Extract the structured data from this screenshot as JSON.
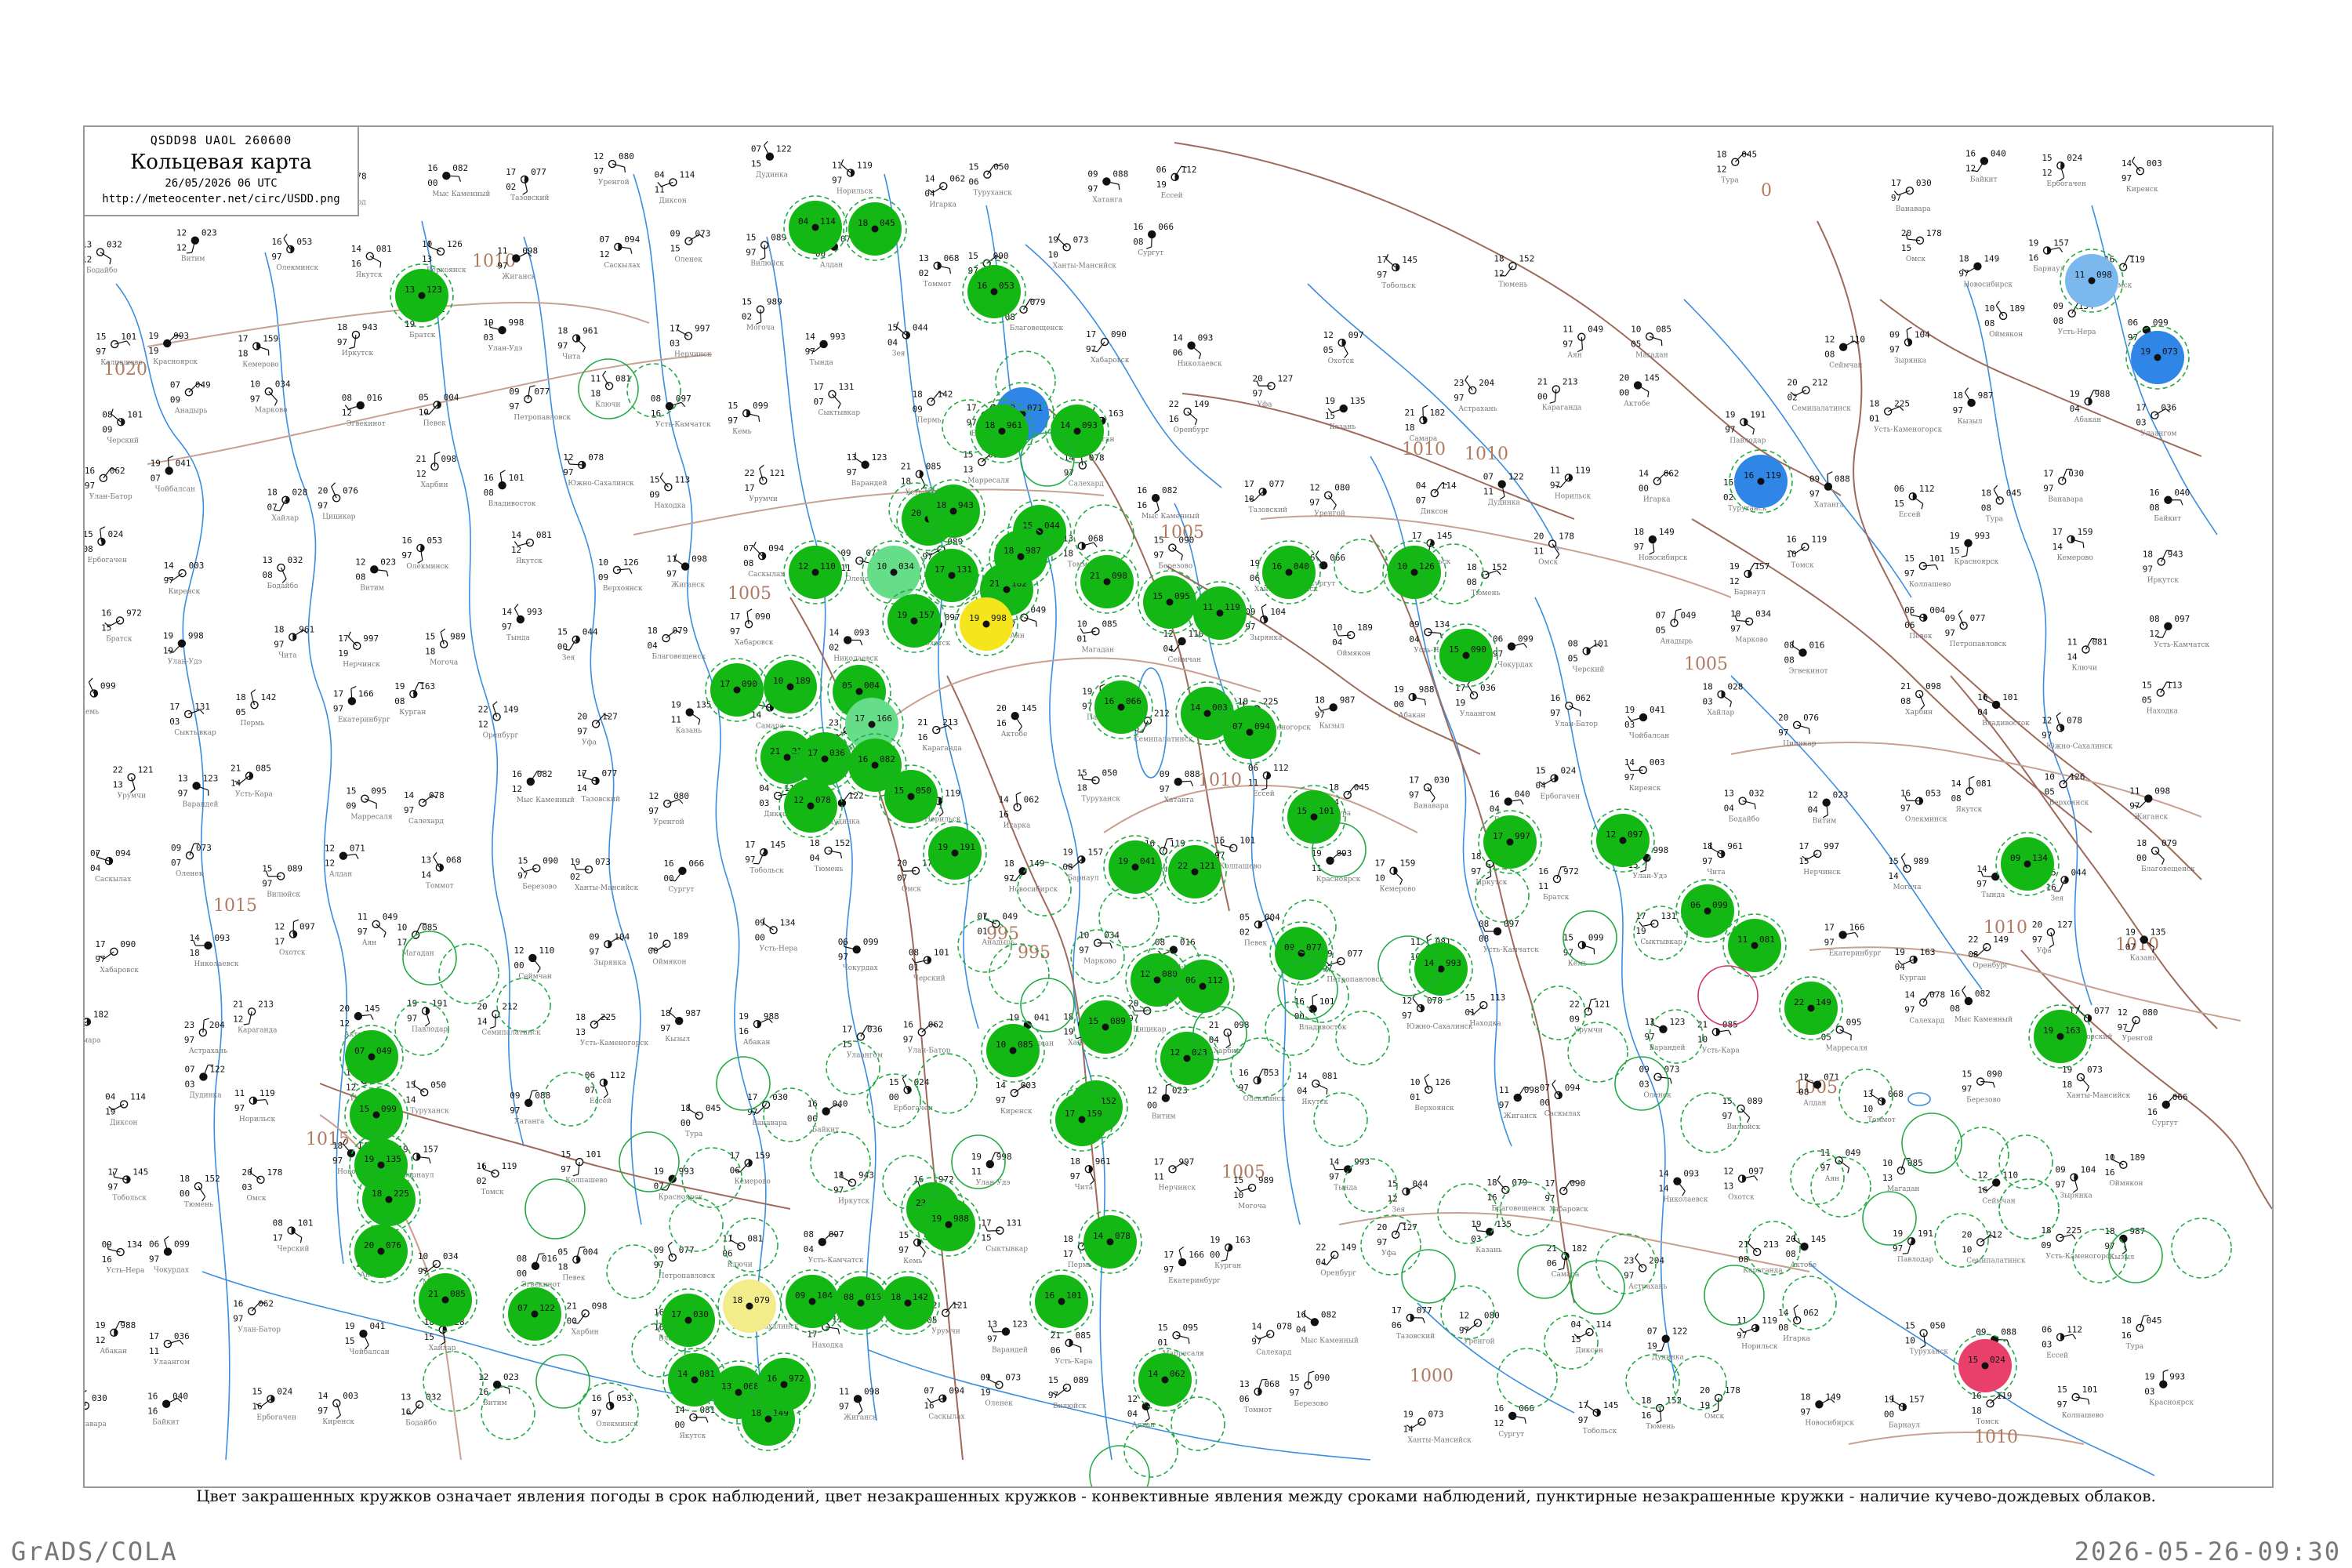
{
  "header": {
    "code": "QSDD98  UAOL  260600",
    "title": "Кольцевая карта",
    "datetime": "26/05/2026 06 UTC",
    "url": "http://meteocenter.net/circ/USDD.png"
  },
  "caption": "Цвет закрашенных кружков означает явления погоды в срок наблюдений, цвет незакрашенных кружков - конвективные явления между сроками наблюдений, пунктирные незакрашенные кружки - наличие кучево-дождевых облаков.",
  "footer": {
    "left": "GrADS/COLA",
    "right": "2026-05-26-09:30"
  },
  "colors": {
    "frame": "#9a9a9a",
    "river": "#3a8ee0",
    "border": "#a06a5a",
    "isobar": "#c9a090",
    "rain_green": "#14b814",
    "light_green": "#66dd88",
    "yellow": "#f5e51c",
    "pale_yellow": "#f2ec8a",
    "blue": "#2f86e6",
    "light_blue": "#7ab8ee",
    "red": "#e8406a",
    "convective_outline": "#22aa44",
    "thunder_outline": "#d03070"
  },
  "isobar_labels": [
    "1020",
    "1015",
    "1010",
    "1010",
    "1005",
    "1005",
    "1010",
    "995",
    "1005",
    "1005",
    "995",
    "1010",
    "1010",
    "1010",
    "1015",
    "1005",
    "1000",
    "1010",
    "0"
  ],
  "stations": [
    {
      "n": "Варандей",
      "p": "123",
      "t": "13"
    },
    {
      "n": "Усть-Кара",
      "p": "085",
      "t": "21"
    },
    {
      "n": "Марресаля",
      "p": "095",
      "t": "15"
    },
    {
      "n": "Салехард",
      "p": "078",
      "t": "14"
    },
    {
      "n": "Мыс Каменный",
      "p": "082",
      "t": "16"
    },
    {
      "n": "Тазовский",
      "p": "077",
      "t": "17"
    },
    {
      "n": "Уренгой",
      "p": "080",
      "t": "12"
    },
    {
      "n": "Диксон",
      "p": "114",
      "t": "04"
    },
    {
      "n": "Дудинка",
      "p": "122",
      "t": "07"
    },
    {
      "n": "Норильск",
      "p": "119",
      "t": "11"
    },
    {
      "n": "Игарка",
      "p": "062",
      "t": "14"
    },
    {
      "n": "Туруханск",
      "p": "050",
      "t": "15"
    },
    {
      "n": "Хатанга",
      "p": "088",
      "t": "09"
    },
    {
      "n": "Ессей",
      "p": "112",
      "t": "06"
    },
    {
      "n": "Тура",
      "p": "045",
      "t": "18"
    },
    {
      "n": "Ванавара",
      "p": "030",
      "t": "17"
    },
    {
      "n": "Байкит",
      "p": "040",
      "t": "16"
    },
    {
      "n": "Ербогачен",
      "p": "024",
      "t": "15"
    },
    {
      "n": "Киренск",
      "p": "003",
      "t": "14"
    },
    {
      "n": "Бодайбо",
      "p": "032",
      "t": "13"
    },
    {
      "n": "Витим",
      "p": "023",
      "t": "12"
    },
    {
      "n": "Олекминск",
      "p": "053",
      "t": "16"
    },
    {
      "n": "Якутск",
      "p": "081",
      "t": "14"
    },
    {
      "n": "Верхоянск",
      "p": "126",
      "t": "10"
    },
    {
      "n": "Жиганск",
      "p": "098",
      "t": "11"
    },
    {
      "n": "Саскылах",
      "p": "094",
      "t": "07"
    },
    {
      "n": "Оленек",
      "p": "073",
      "t": "09"
    },
    {
      "n": "Вилюйск",
      "p": "089",
      "t": "15"
    },
    {
      "n": "Алдан",
      "p": "071",
      "t": "12"
    },
    {
      "n": "Томмот",
      "p": "068",
      "t": "13"
    },
    {
      "n": "Березово",
      "p": "090",
      "t": "15"
    },
    {
      "n": "Ханты-Мансийск",
      "p": "073",
      "t": "19"
    },
    {
      "n": "Сургут",
      "p": "066",
      "t": "16"
    },
    {
      "n": "Тобольск",
      "p": "145",
      "t": "17"
    },
    {
      "n": "Тюмень",
      "p": "152",
      "t": "18"
    },
    {
      "n": "Омск",
      "p": "178",
      "t": "20"
    },
    {
      "n": "Новосибирск",
      "p": "149",
      "t": "18"
    },
    {
      "n": "Барнаул",
      "p": "157",
      "t": "19"
    },
    {
      "n": "Томск",
      "p": "119",
      "t": "16"
    },
    {
      "n": "Колпашево",
      "p": "101",
      "t": "15"
    },
    {
      "n": "Красноярск",
      "p": "993",
      "t": "19"
    },
    {
      "n": "Кемерово",
      "p": "159",
      "t": "17"
    },
    {
      "n": "Иркутск",
      "p": "943",
      "t": "18"
    },
    {
      "n": "Братск",
      "p": "972",
      "t": "16"
    },
    {
      "n": "Улан-Удэ",
      "p": "998",
      "t": "19"
    },
    {
      "n": "Чита",
      "p": "961",
      "t": "18"
    },
    {
      "n": "Нерчинск",
      "p": "997",
      "t": "17"
    },
    {
      "n": "Могоча",
      "p": "989",
      "t": "15"
    },
    {
      "n": "Тында",
      "p": "993",
      "t": "14"
    },
    {
      "n": "Зея",
      "p": "044",
      "t": "15"
    },
    {
      "n": "Благовещенск",
      "p": "079",
      "t": "18"
    },
    {
      "n": "Хабаровск",
      "p": "090",
      "t": "17"
    },
    {
      "n": "Николаевск",
      "p": "093",
      "t": "14"
    },
    {
      "n": "Охотск",
      "p": "097",
      "t": "12"
    },
    {
      "n": "Аян",
      "p": "049",
      "t": "11"
    },
    {
      "n": "Магадан",
      "p": "085",
      "t": "10"
    },
    {
      "n": "Сеймчан",
      "p": "110",
      "t": "12"
    },
    {
      "n": "Зырянка",
      "p": "104",
      "t": "09"
    },
    {
      "n": "Оймякон",
      "p": "189",
      "t": "10"
    },
    {
      "n": "Усть-Нера",
      "p": "134",
      "t": "09"
    },
    {
      "n": "Чокурдах",
      "p": "099",
      "t": "06"
    },
    {
      "n": "Черский",
      "p": "101",
      "t": "08"
    },
    {
      "n": "Анадырь",
      "p": "049",
      "t": "07"
    },
    {
      "n": "Марково",
      "p": "034",
      "t": "10"
    },
    {
      "n": "Эгвекинот",
      "p": "016",
      "t": "08"
    },
    {
      "n": "Певек",
      "p": "004",
      "t": "05"
    },
    {
      "n": "Петропавловск",
      "p": "077",
      "t": "09"
    },
    {
      "n": "Ключи",
      "p": "081",
      "t": "11"
    },
    {
      "n": "Усть-Камчатск",
      "p": "097",
      "t": "08"
    },
    {
      "n": "Кемь",
      "p": "099",
      "t": "15"
    },
    {
      "n": "Сыктывкар",
      "p": "131",
      "t": "17"
    },
    {
      "n": "Пермь",
      "p": "142",
      "t": "18"
    },
    {
      "n": "Екатеринбург",
      "p": "166",
      "t": "17"
    },
    {
      "n": "Курган",
      "p": "163",
      "t": "19"
    },
    {
      "n": "Оренбург",
      "p": "149",
      "t": "22"
    },
    {
      "n": "Уфа",
      "p": "127",
      "t": "20"
    },
    {
      "n": "Казань",
      "p": "135",
      "t": "19"
    },
    {
      "n": "Самара",
      "p": "182",
      "t": "21"
    },
    {
      "n": "Астрахань",
      "p": "204",
      "t": "23"
    },
    {
      "n": "Караганда",
      "p": "213",
      "t": "21"
    },
    {
      "n": "Актобе",
      "p": "145",
      "t": "20"
    },
    {
      "n": "Павлодар",
      "p": "191",
      "t": "19"
    },
    {
      "n": "Семипалатинск",
      "p": "212",
      "t": "20"
    },
    {
      "n": "Усть-Каменогорск",
      "p": "225",
      "t": "18"
    },
    {
      "n": "Кызыл",
      "p": "987",
      "t": "18"
    },
    {
      "n": "Абакан",
      "p": "988",
      "t": "19"
    },
    {
      "n": "Улаангом",
      "p": "036",
      "t": "17"
    },
    {
      "n": "Улан-Батор",
      "p": "062",
      "t": "16"
    },
    {
      "n": "Чойбалсан",
      "p": "041",
      "t": "19"
    },
    {
      "n": "Хайлар",
      "p": "028",
      "t": "18"
    },
    {
      "n": "Цицикар",
      "p": "076",
      "t": "20"
    },
    {
      "n": "Харбин",
      "p": "098",
      "t": "21"
    },
    {
      "n": "Владивосток",
      "p": "101",
      "t": "16"
    },
    {
      "n": "Южно-Сахалинск",
      "p": "078",
      "t": "12"
    },
    {
      "n": "Находка",
      "p": "113",
      "t": "15"
    },
    {
      "n": "Урумчи",
      "p": "121",
      "t": "22"
    }
  ]
}
